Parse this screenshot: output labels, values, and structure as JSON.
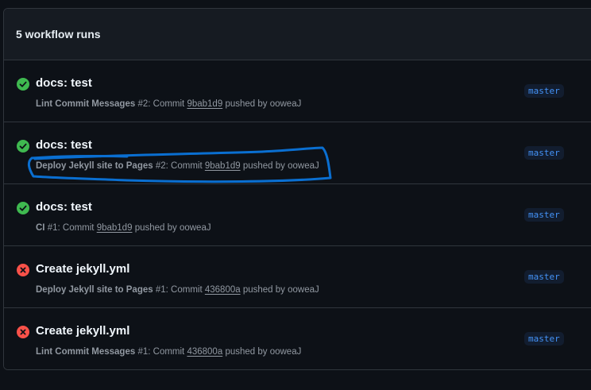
{
  "header": {
    "title": "5 workflow runs"
  },
  "colors": {
    "success": "#3fb950",
    "failure": "#f85149",
    "branch_text": "#4493f8",
    "annotation": "#0a6fd1"
  },
  "runs": [
    {
      "status": "success",
      "status_icon": "check-circle-icon",
      "title": "docs: test",
      "workflow": "Lint Commit Messages",
      "run_number": "#2",
      "commit_label": ": Commit",
      "sha": "9bab1d9",
      "pushed_by": "pushed by ooweaJ",
      "branch": "master"
    },
    {
      "status": "success",
      "status_icon": "check-circle-icon",
      "title": "docs: test",
      "workflow": "Deploy Jekyll site to Pages",
      "run_number": "#2",
      "commit_label": ": Commit",
      "sha": "9bab1d9",
      "pushed_by": "pushed by ooweaJ",
      "branch": "master"
    },
    {
      "status": "success",
      "status_icon": "check-circle-icon",
      "title": "docs: test",
      "workflow": "CI",
      "run_number": "#1",
      "commit_label": ": Commit",
      "sha": "9bab1d9",
      "pushed_by": "pushed by ooweaJ",
      "branch": "master"
    },
    {
      "status": "failure",
      "status_icon": "x-circle-icon",
      "title": "Create jekyll.yml",
      "workflow": "Deploy Jekyll site to Pages",
      "run_number": "#1",
      "commit_label": ": Commit",
      "sha": "436800a",
      "pushed_by": "pushed by ooweaJ",
      "branch": "master"
    },
    {
      "status": "failure",
      "status_icon": "x-circle-icon",
      "title": "Create jekyll.yml",
      "workflow": "Lint Commit Messages",
      "run_number": "#1",
      "commit_label": ": Commit",
      "sha": "436800a",
      "pushed_by": "pushed by ooweaJ",
      "branch": "master"
    }
  ]
}
